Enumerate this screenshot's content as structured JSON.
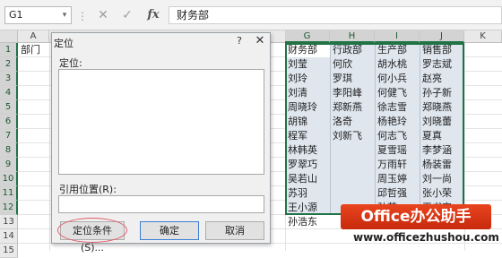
{
  "formula_bar": {
    "name_box": "G1",
    "name_box_arrow": "▾",
    "separator": "⋮",
    "cancel_glyph": "✕",
    "enter_glyph": "✓",
    "fx_label": "fx",
    "formula": "财务部"
  },
  "columns": {
    "left": [
      "A"
    ],
    "right": [
      "G",
      "H",
      "I",
      "J",
      "K"
    ]
  },
  "rows": [
    "1",
    "2",
    "3",
    "4",
    "5",
    "6",
    "7",
    "8",
    "9",
    "10",
    "11",
    "12",
    "13",
    "14",
    "15"
  ],
  "cells": {
    "a1": "部门"
  },
  "table": {
    "headers": [
      "财务部",
      "行政部",
      "生产部",
      "销售部"
    ],
    "rows": [
      [
        "刘莹",
        "何欣",
        "胡水桃",
        "罗志斌"
      ],
      [
        "刘玲",
        "罗琪",
        "何小兵",
        "赵亮"
      ],
      [
        "刘清",
        "李阳峰",
        "何健飞",
        "孙子新"
      ],
      [
        "周晓玲",
        "郑新燕",
        "徐志雪",
        "郑晓燕"
      ],
      [
        "胡锦",
        "洛奇",
        "杨艳玲",
        "刘晓蕾"
      ],
      [
        "程军",
        "刘新飞",
        "何志飞",
        "夏真"
      ],
      [
        "林韩英",
        "",
        "夏雪瑶",
        "李梦涵"
      ],
      [
        "罗翠巧",
        "",
        "万雨轩",
        "杨装雷"
      ],
      [
        "吴若山",
        "",
        "周玉婷",
        "刘一尚"
      ],
      [
        "苏羽",
        "",
        "邱哲强",
        "张小荣"
      ],
      [
        "王小源",
        "",
        "孙莹",
        "王书安"
      ],
      [
        "孙浩东",
        "",
        "",
        ""
      ]
    ]
  },
  "dialog": {
    "title": "定位",
    "help_label": "?",
    "close_label": "✕",
    "goto_label": "定位:",
    "reference_label": "引用位置(R):",
    "reference_value": "",
    "special_button": "定位条件(S)...",
    "ok_button": "确定",
    "cancel_button": "取消"
  },
  "watermark": {
    "logo_text": "Office办公助手",
    "url": "www.officezhushou.com"
  },
  "colors": {
    "accent_green": "#217346",
    "selection_fill": "#dfe6ee",
    "annotation_red": "#e05a6a",
    "logo_red": "#d9381a"
  }
}
